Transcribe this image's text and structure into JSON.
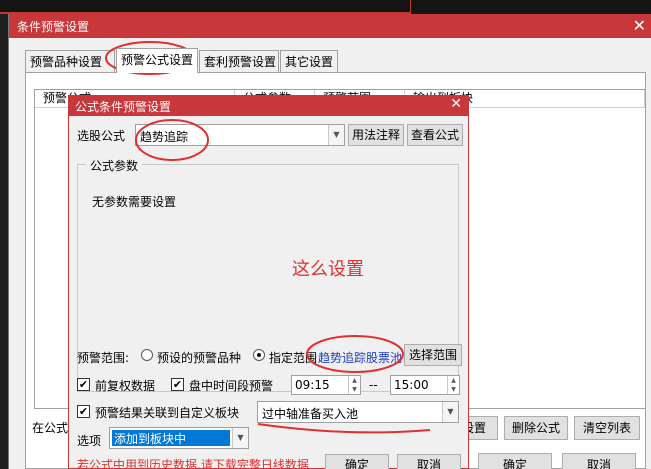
{
  "window": {
    "title": "条件预警设置",
    "close_glyph": "✕"
  },
  "tabs": [
    {
      "label": "预警品种设置"
    },
    {
      "label": "预警公式设置"
    },
    {
      "label": "套利预警设置"
    },
    {
      "label": "其它设置"
    }
  ],
  "table": {
    "columns": [
      "预警公式",
      "公式参数",
      "预警范围",
      "输出到板块"
    ]
  },
  "bottom": {
    "left_label": "在公式",
    "buttons": [
      "设置",
      "删除公式",
      "清空列表"
    ],
    "ok": "确定",
    "cancel": "取消"
  },
  "dialog": {
    "title": "公式条件预警设置",
    "close_glyph": "✕",
    "formula_label": "选股公式",
    "formula_value": "趋势追踪",
    "usage_button": "用法注释",
    "view_button": "查看公式",
    "params_group": "公式参数",
    "params_text": "无参数需要设置",
    "annotation": "这么设置",
    "range_label": "预警范围:",
    "radio_preset": "预设的预警品种",
    "radio_specified": "指定范围",
    "range_value": "趋势追踪股票池",
    "select_range_button": "选择范围",
    "chk_fuquan": "前复权数据",
    "chk_intraday": "盘中时间段预警",
    "time_start": "09:15",
    "time_sep": "--",
    "time_end": "15:00",
    "chk_link": "预警结果关联到自定义板块",
    "block_value": "过中轴准备买入池",
    "option_label": "选项",
    "option_value": "添加到板块中",
    "warning": "若公式中用到历史数据,请下载完整日线数据",
    "ok": "确定",
    "cancel": "取消"
  },
  "colors": {
    "accent": "#c8373a",
    "annotation_red": "#e03030",
    "selected_blue": "#0078d7",
    "link_blue": "#1a3cc8"
  }
}
